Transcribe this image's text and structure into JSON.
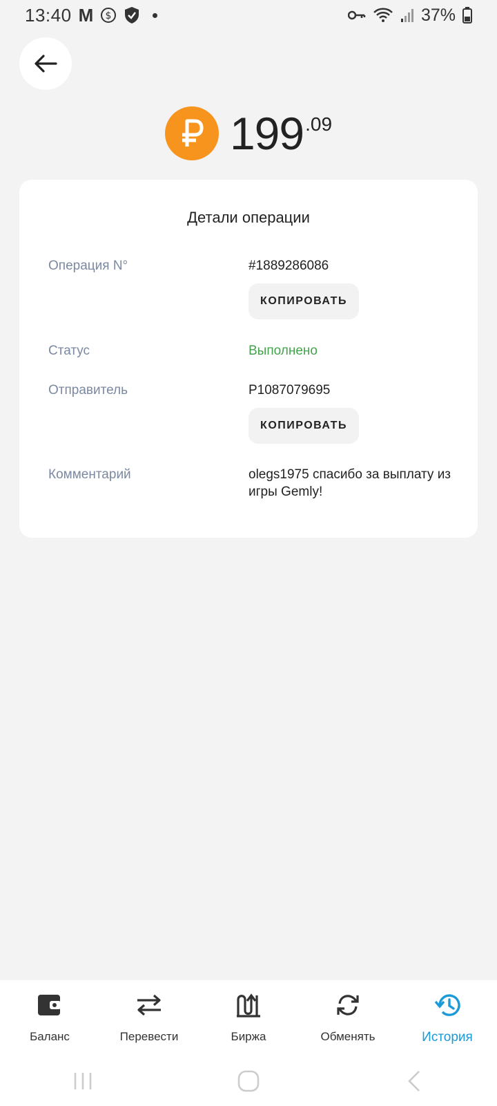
{
  "status_bar": {
    "time": "13:40",
    "m_badge": "M",
    "battery": "37%",
    "icons": [
      "dollar-circle-icon",
      "shield-check-icon",
      "dot-icon",
      "key-icon",
      "wifi-icon",
      "signal-icon",
      "battery-icon"
    ]
  },
  "header": {
    "back_icon": "arrow-left-icon"
  },
  "amount": {
    "currency_icon": "ruble-coin-icon",
    "integer": "199",
    "fraction": ".09",
    "accent_color": "#f7941d"
  },
  "details": {
    "title": "Детали операции",
    "operation_label": "Операция N°",
    "operation_value": "#1889286086",
    "copy_label": "КОПИРОВАТЬ",
    "status_label": "Статус",
    "status_value": "Выполнено",
    "status_color": "#43a34c",
    "sender_label": "Отправитель",
    "sender_value": "P1087079695",
    "comment_label": "Комментарий",
    "comment_value": "olegs1975 спасибо за выплату из игры Gemly!"
  },
  "bottom_nav": {
    "active_color": "#1a9ad6",
    "items": [
      {
        "label": "Баланс",
        "icon": "wallet-icon"
      },
      {
        "label": "Перевести",
        "icon": "transfer-arrows-icon"
      },
      {
        "label": "Биржа",
        "icon": "exchange-chart-icon"
      },
      {
        "label": "Обменять",
        "icon": "swap-circle-icon"
      },
      {
        "label": "История",
        "icon": "history-icon",
        "active": true
      }
    ]
  },
  "system_nav": {
    "icons": [
      "recent-apps-icon",
      "home-icon",
      "back-icon"
    ]
  }
}
